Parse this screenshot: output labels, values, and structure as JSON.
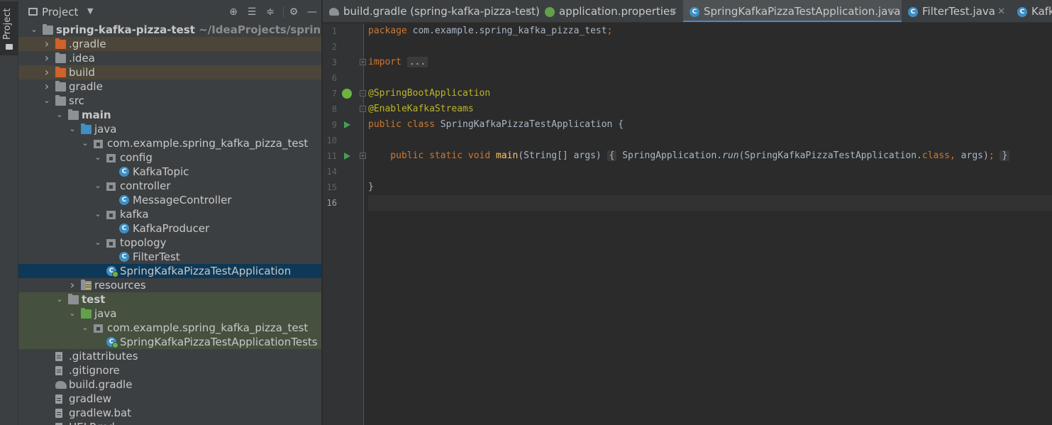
{
  "sidebar": {
    "tool_tab_label": "Project"
  },
  "project_panel": {
    "title": "Project",
    "tree": [
      {
        "label": "spring-kafka-pizza-test",
        "path": "~/IdeaProjects/spring-kafka-p",
        "icon": "module-folder-icon",
        "depth": 0,
        "expanded": true,
        "bold": true
      },
      {
        "label": ".gradle",
        "icon": "excluded-folder-icon",
        "depth": 1,
        "expanded": false
      },
      {
        "label": ".idea",
        "icon": "folder-icon",
        "depth": 1,
        "expanded": false
      },
      {
        "label": "build",
        "icon": "excluded-folder-icon",
        "depth": 1,
        "expanded": false
      },
      {
        "label": "gradle",
        "icon": "folder-icon",
        "depth": 1,
        "expanded": false
      },
      {
        "label": "src",
        "icon": "folder-icon",
        "depth": 1,
        "expanded": true
      },
      {
        "label": "main",
        "icon": "folder-icon",
        "depth": 2,
        "expanded": true,
        "bold": true
      },
      {
        "label": "java",
        "icon": "source-folder-icon",
        "depth": 3,
        "expanded": true
      },
      {
        "label": "com.example.spring_kafka_pizza_test",
        "icon": "package-icon",
        "depth": 4,
        "expanded": true
      },
      {
        "label": "config",
        "icon": "package-icon",
        "depth": 5,
        "expanded": true
      },
      {
        "label": "KafkaTopic",
        "icon": "class-icon",
        "depth": 6
      },
      {
        "label": "controller",
        "icon": "package-icon",
        "depth": 5,
        "expanded": true
      },
      {
        "label": "MessageController",
        "icon": "class-icon",
        "depth": 6
      },
      {
        "label": "kafka",
        "icon": "package-icon",
        "depth": 5,
        "expanded": true
      },
      {
        "label": "KafkaProducer",
        "icon": "class-icon",
        "depth": 6
      },
      {
        "label": "topology",
        "icon": "package-icon",
        "depth": 5,
        "expanded": true
      },
      {
        "label": "FilterTest",
        "icon": "class-icon",
        "depth": 6
      },
      {
        "label": "SpringKafkaPizzaTestApplication",
        "icon": "spring-boot-class-icon",
        "depth": 5,
        "selected": true
      },
      {
        "label": "resources",
        "icon": "resources-folder-icon",
        "depth": 3,
        "expanded": false
      },
      {
        "label": "test",
        "icon": "folder-icon",
        "depth": 2,
        "expanded": true,
        "bold": true
      },
      {
        "label": "java",
        "icon": "test-source-folder-icon",
        "depth": 3,
        "expanded": true
      },
      {
        "label": "com.example.spring_kafka_pizza_test",
        "icon": "package-icon",
        "depth": 4,
        "expanded": true
      },
      {
        "label": "SpringKafkaPizzaTestApplicationTests",
        "icon": "test-class-icon",
        "depth": 5
      },
      {
        "label": ".gitattributes",
        "icon": "text-file-icon",
        "depth": 1
      },
      {
        "label": ".gitignore",
        "icon": "gitignore-file-icon",
        "depth": 1
      },
      {
        "label": "build.gradle",
        "icon": "gradle-icon",
        "depth": 1
      },
      {
        "label": "gradlew",
        "icon": "shell-file-icon",
        "depth": 1
      },
      {
        "label": "gradlew.bat",
        "icon": "text-file-icon",
        "depth": 1
      },
      {
        "label": "HELP.md",
        "icon": "markdown-file-icon",
        "depth": 1
      }
    ]
  },
  "editor_tabs": [
    {
      "label": "build.gradle (spring-kafka-pizza-test)",
      "icon": "gradle-icon",
      "active": false
    },
    {
      "label": "application.properties",
      "icon": "spring-properties-icon",
      "active": false
    },
    {
      "label": "SpringKafkaPizzaTestApplication.java",
      "icon": "class-icon",
      "active": true
    },
    {
      "label": "FilterTest.java",
      "icon": "class-icon",
      "active": false
    },
    {
      "label": "Kafk",
      "icon": "class-icon",
      "active": false
    }
  ],
  "editor": {
    "current_line": "16",
    "lines": [
      {
        "n": "1",
        "tokens": [
          {
            "t": "package ",
            "c": "kw"
          },
          {
            "t": "com.example.spring_kafka_pizza_test",
            "c": ""
          },
          {
            "t": ";",
            "c": "kw"
          }
        ]
      },
      {
        "n": "2",
        "tokens": []
      },
      {
        "n": "3",
        "tokens": [
          {
            "t": "import ",
            "c": "kw"
          },
          {
            "t": "...",
            "c": "foldbox"
          }
        ],
        "fold": "+"
      },
      {
        "n": "6",
        "tokens": []
      },
      {
        "n": "7",
        "tokens": [
          {
            "t": "@SpringBootApplication",
            "c": "ann"
          }
        ],
        "gutter_icon": "spring-bean-icon",
        "fold": "-"
      },
      {
        "n": "8",
        "tokens": [
          {
            "t": "@EnableKafkaStreams",
            "c": "ann"
          }
        ],
        "fold": "-"
      },
      {
        "n": "9",
        "tokens": [
          {
            "t": "public class ",
            "c": "kw"
          },
          {
            "t": "SpringKafkaPizzaTestApplication {",
            "c": ""
          }
        ],
        "gutter_icon": "run-icon"
      },
      {
        "n": "10",
        "tokens": []
      },
      {
        "n": "11",
        "tokens": [
          {
            "t": "    public static void ",
            "c": "kw"
          },
          {
            "t": "main",
            "c": "fn"
          },
          {
            "t": "(String[] args) ",
            "c": ""
          },
          {
            "t": "{",
            "c": "foldbox"
          },
          {
            "t": " SpringApplication.",
            "c": ""
          },
          {
            "t": "run",
            "c": "it"
          },
          {
            "t": "(SpringKafkaPizzaTestApplication.",
            "c": ""
          },
          {
            "t": "class",
            "c": "kw"
          },
          {
            "t": ", ",
            "c": "kw"
          },
          {
            "t": "args)",
            "c": ""
          },
          {
            "t": ";",
            "c": "kw"
          },
          {
            "t": " ",
            "c": ""
          },
          {
            "t": "}",
            "c": "foldbox"
          }
        ],
        "gutter_icon": "run-icon",
        "fold": "+"
      },
      {
        "n": "14",
        "tokens": []
      },
      {
        "n": "15",
        "tokens": [
          {
            "t": "}",
            "c": ""
          }
        ]
      },
      {
        "n": "16",
        "tokens": []
      }
    ]
  }
}
